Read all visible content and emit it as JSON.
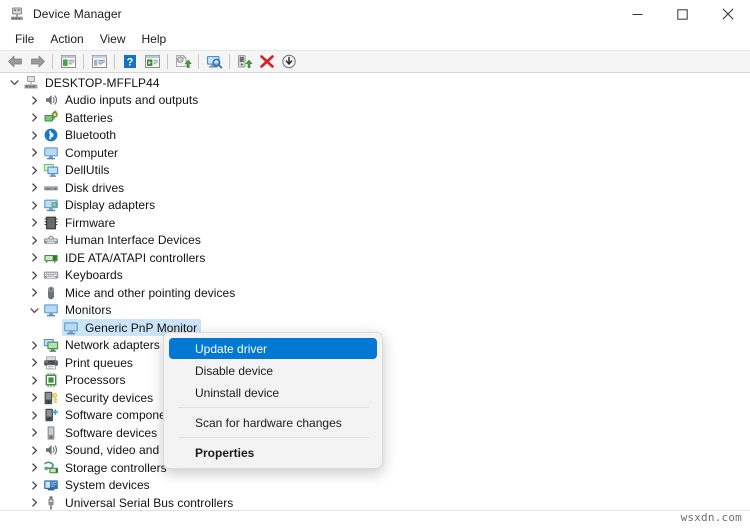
{
  "window": {
    "title": "Device Manager",
    "icon": "device-manager-icon",
    "caption": {
      "minimize": "minimize-icon",
      "maximize": "maximize-icon",
      "close": "close-icon"
    }
  },
  "menubar": {
    "items": [
      {
        "label": "File"
      },
      {
        "label": "Action"
      },
      {
        "label": "View"
      },
      {
        "label": "Help"
      }
    ]
  },
  "toolbar": {
    "buttons": [
      {
        "name": "back-icon",
        "title": "Back"
      },
      {
        "name": "forward-icon",
        "title": "Forward"
      },
      {
        "name": "separator",
        "title": ""
      },
      {
        "name": "show-hide-console-tree-icon",
        "title": "Show/Hide Console Tree"
      },
      {
        "name": "separator",
        "title": ""
      },
      {
        "name": "properties-icon",
        "title": "Properties"
      },
      {
        "name": "separator",
        "title": ""
      },
      {
        "name": "help-icon",
        "title": "Help"
      },
      {
        "name": "view-icon",
        "title": "View"
      },
      {
        "name": "separator",
        "title": ""
      },
      {
        "name": "update-driver-icon",
        "title": "Update driver"
      },
      {
        "name": "separator",
        "title": ""
      },
      {
        "name": "scan-hardware-changes-icon",
        "title": "Scan for hardware changes"
      },
      {
        "name": "separator",
        "title": ""
      },
      {
        "name": "enable-device-icon",
        "title": "Enable device"
      },
      {
        "name": "uninstall-device-icon",
        "title": "Uninstall device"
      },
      {
        "name": "disable-device-icon",
        "title": "Disable device"
      }
    ]
  },
  "tree": {
    "nodes": [
      {
        "label": "DESKTOP-MFFLP44",
        "icon": "computer-root-icon",
        "indent": 0,
        "state": "expanded",
        "selected": false
      },
      {
        "label": "Audio inputs and outputs",
        "icon": "audio-icon",
        "indent": 1,
        "state": "collapsed",
        "selected": false
      },
      {
        "label": "Batteries",
        "icon": "battery-icon",
        "indent": 1,
        "state": "collapsed",
        "selected": false
      },
      {
        "label": "Bluetooth",
        "icon": "bluetooth-icon",
        "indent": 1,
        "state": "collapsed",
        "selected": false
      },
      {
        "label": "Computer",
        "icon": "monitor-icon",
        "indent": 1,
        "state": "collapsed",
        "selected": false
      },
      {
        "label": "DellUtils",
        "icon": "dell-utils-icon",
        "indent": 1,
        "state": "collapsed",
        "selected": false
      },
      {
        "label": "Disk drives",
        "icon": "disk-drive-icon",
        "indent": 1,
        "state": "collapsed",
        "selected": false
      },
      {
        "label": "Display adapters",
        "icon": "display-adapter-icon",
        "indent": 1,
        "state": "collapsed",
        "selected": false
      },
      {
        "label": "Firmware",
        "icon": "firmware-icon",
        "indent": 1,
        "state": "collapsed",
        "selected": false
      },
      {
        "label": "Human Interface Devices",
        "icon": "hid-icon",
        "indent": 1,
        "state": "collapsed",
        "selected": false
      },
      {
        "label": "IDE ATA/ATAPI controllers",
        "icon": "ide-controller-icon",
        "indent": 1,
        "state": "collapsed",
        "selected": false
      },
      {
        "label": "Keyboards",
        "icon": "keyboard-icon",
        "indent": 1,
        "state": "collapsed",
        "selected": false
      },
      {
        "label": "Mice and other pointing devices",
        "icon": "mouse-icon",
        "indent": 1,
        "state": "collapsed",
        "selected": false
      },
      {
        "label": "Monitors",
        "icon": "monitor-icon",
        "indent": 1,
        "state": "expanded",
        "selected": false
      },
      {
        "label": "Generic PnP Monitor",
        "icon": "monitor-icon",
        "indent": 2,
        "state": "leaf",
        "selected": true
      },
      {
        "label": "Network adapters",
        "icon": "network-adapter-icon",
        "indent": 1,
        "state": "collapsed",
        "selected": false
      },
      {
        "label": "Print queues",
        "icon": "printer-icon",
        "indent": 1,
        "state": "collapsed",
        "selected": false
      },
      {
        "label": "Processors",
        "icon": "processor-icon",
        "indent": 1,
        "state": "collapsed",
        "selected": false
      },
      {
        "label": "Security devices",
        "icon": "security-device-icon",
        "indent": 1,
        "state": "collapsed",
        "selected": false
      },
      {
        "label": "Software components",
        "icon": "software-component-icon",
        "indent": 1,
        "state": "collapsed",
        "selected": false
      },
      {
        "label": "Software devices",
        "icon": "software-device-icon",
        "indent": 1,
        "state": "collapsed",
        "selected": false
      },
      {
        "label": "Sound, video and game controllers",
        "icon": "audio-icon",
        "indent": 1,
        "state": "collapsed",
        "selected": false
      },
      {
        "label": "Storage controllers",
        "icon": "storage-controller-icon",
        "indent": 1,
        "state": "collapsed",
        "selected": false
      },
      {
        "label": "System devices",
        "icon": "system-device-icon",
        "indent": 1,
        "state": "collapsed",
        "selected": false
      },
      {
        "label": "Universal Serial Bus controllers",
        "icon": "usb-icon",
        "indent": 1,
        "state": "collapsed",
        "selected": false
      }
    ]
  },
  "context_menu": {
    "items": [
      {
        "label": "Update driver",
        "type": "item",
        "highlighted": true,
        "bold": false
      },
      {
        "label": "Disable device",
        "type": "item",
        "highlighted": false,
        "bold": false
      },
      {
        "label": "Uninstall device",
        "type": "item",
        "highlighted": false,
        "bold": false
      },
      {
        "label": "",
        "type": "separator",
        "highlighted": false,
        "bold": false
      },
      {
        "label": "Scan for hardware changes",
        "type": "item",
        "highlighted": false,
        "bold": false
      },
      {
        "label": "",
        "type": "separator",
        "highlighted": false,
        "bold": false
      },
      {
        "label": "Properties",
        "type": "item",
        "highlighted": false,
        "bold": true
      }
    ]
  },
  "watermark": {
    "text": "wsxdn.com"
  },
  "colors": {
    "accent": "#0078d4",
    "selection": "#cce4f7",
    "toolbar_bg": "#f5f5f5",
    "menu_bg": "#f3f3f3"
  }
}
